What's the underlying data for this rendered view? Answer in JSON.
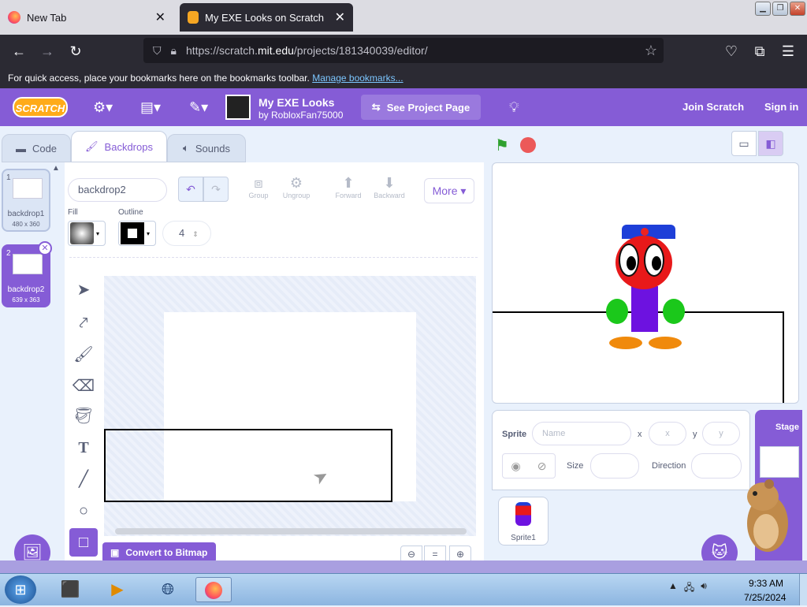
{
  "browser": {
    "tabs": [
      {
        "title": "New Tab"
      },
      {
        "title": "My EXE Looks on Scratch"
      }
    ],
    "url_prefix": "https://scratch.",
    "url_domain": "mit.edu",
    "url_path": "/projects/181340039/editor/",
    "bookmarks_prompt": "For quick access, place your bookmarks here on the bookmarks toolbar.",
    "bookmarks_link": "Manage bookmarks..."
  },
  "menu": {
    "logo": "SCRATCH",
    "project_title": "My EXE Looks",
    "project_author": "by RobloxFan75000",
    "see_project": "See Project Page",
    "join": "Join Scratch",
    "signin": "Sign in"
  },
  "editor_tabs": [
    "Code",
    "Backdrops",
    "Sounds"
  ],
  "backdrops": [
    {
      "num": "1",
      "name": "backdrop1",
      "size": "480 x 360"
    },
    {
      "num": "2",
      "name": "backdrop2",
      "size": "639 x 363"
    }
  ],
  "paint": {
    "backdrop_name": "backdrop2",
    "group": "Group",
    "ungroup": "Ungroup",
    "forward": "Forward",
    "backward": "Backward",
    "more": "More",
    "fill_label": "Fill",
    "outline_label": "Outline",
    "outline_width": "4",
    "convert_bitmap": "Convert to Bitmap",
    "zoom_reset": "="
  },
  "sprite_info": {
    "sprite_label": "Sprite",
    "name_placeholder": "Name",
    "x_label": "x",
    "y_label": "y",
    "x_placeholder": "x",
    "y_placeholder": "y",
    "size_label": "Size",
    "direction_label": "Direction",
    "sprite_name": "Sprite1",
    "stage_label": "Stage"
  },
  "taskbar": {
    "time": "9:33 AM",
    "date": "7/25/2024"
  },
  "colors": {
    "scratch_purple": "#855cd6",
    "scratch_orange": "#ffab19",
    "firefox_dark": "#2b2a33"
  }
}
